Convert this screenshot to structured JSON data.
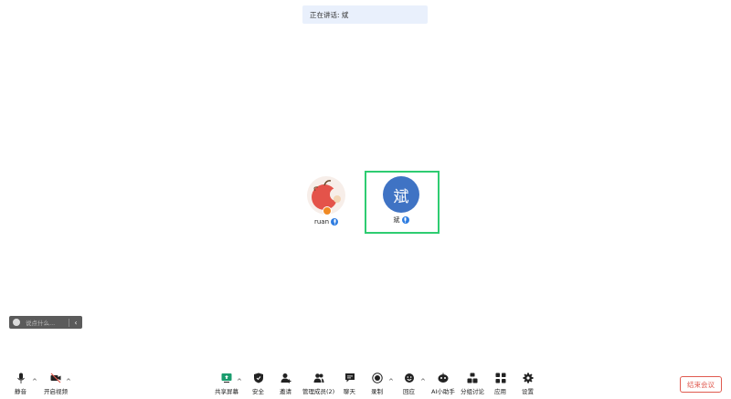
{
  "speaking_banner": "正在讲话: 斌",
  "participants": [
    {
      "name": "ruan",
      "avatar": "apple-image"
    },
    {
      "name": "斌",
      "avatar_text": "斌"
    }
  ],
  "chat": {
    "placeholder": "说点什么..."
  },
  "toolbar": {
    "mute": "静音",
    "video": "开启视频",
    "share": "共享屏幕",
    "security": "安全",
    "invite": "邀请",
    "manage": "管理成员(2)",
    "chat": "聊天",
    "record": "录制",
    "reaction": "回应",
    "ai": "AI小助手",
    "breakout": "分组讨论",
    "apps": "应用",
    "settings": "设置"
  },
  "end_meeting": "结束会议",
  "colors": {
    "accent": "#2f7de1",
    "active_speaker": "#2ecc71",
    "end": "#e05a4f"
  }
}
